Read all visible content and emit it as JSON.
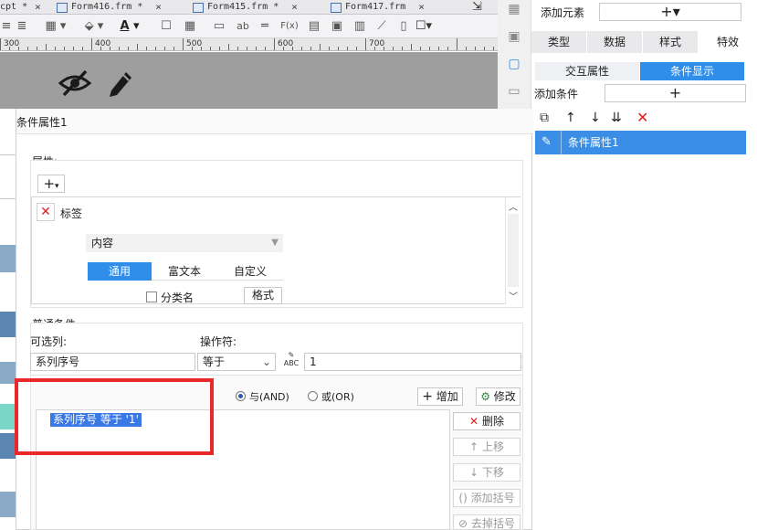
{
  "tabs": [
    {
      "label": "cpt *"
    },
    {
      "label": "Form416.frm *"
    },
    {
      "label": "Form415.frm *"
    },
    {
      "label": "Form417.frm"
    }
  ],
  "toolbar": {
    "font_color_glyph": "A",
    "text_glyph": "ab",
    "formula_glyph": "F(x)"
  },
  "ruler": {
    "labels": [
      "300",
      "400",
      "500",
      "600",
      "700"
    ]
  },
  "panel": {
    "add_element_label": "添加元素",
    "tabs": [
      "类型",
      "数据",
      "样式",
      "特效"
    ],
    "subtabs": [
      "交互属性",
      "条件显示"
    ],
    "add_condition_label": "添加条件",
    "condition_items": [
      {
        "label": "条件属性1"
      }
    ]
  },
  "dialog": {
    "title": "条件属性1",
    "attr_label": "属性:",
    "attr_item_label": "标签",
    "content_select": "内容",
    "content_tabs": [
      "通用",
      "富文本",
      "自定义"
    ],
    "classify_label": "分类名",
    "format_button": "格式",
    "common_cond_label": "普通条件",
    "column_label": "可选列:",
    "operator_label": "操作符:",
    "column_value": "系列序号",
    "operator_value": "等于",
    "value_field": "1",
    "and_label": "与(AND)",
    "or_label": "或(OR)",
    "add_button": "增加",
    "modify_button": "修改",
    "delete_button": "删除",
    "move_up_button": "上移",
    "move_down_button": "下移",
    "add_bracket_button": "添加括号",
    "remove_bracket_button": "去掉括号",
    "condition_entry": "系列序号 等于 '1'"
  },
  "colors": {
    "accent": "#2f8eea",
    "highlight": "#3b78e7",
    "red_box": "#e8282b",
    "delete_red": "#e02020"
  }
}
